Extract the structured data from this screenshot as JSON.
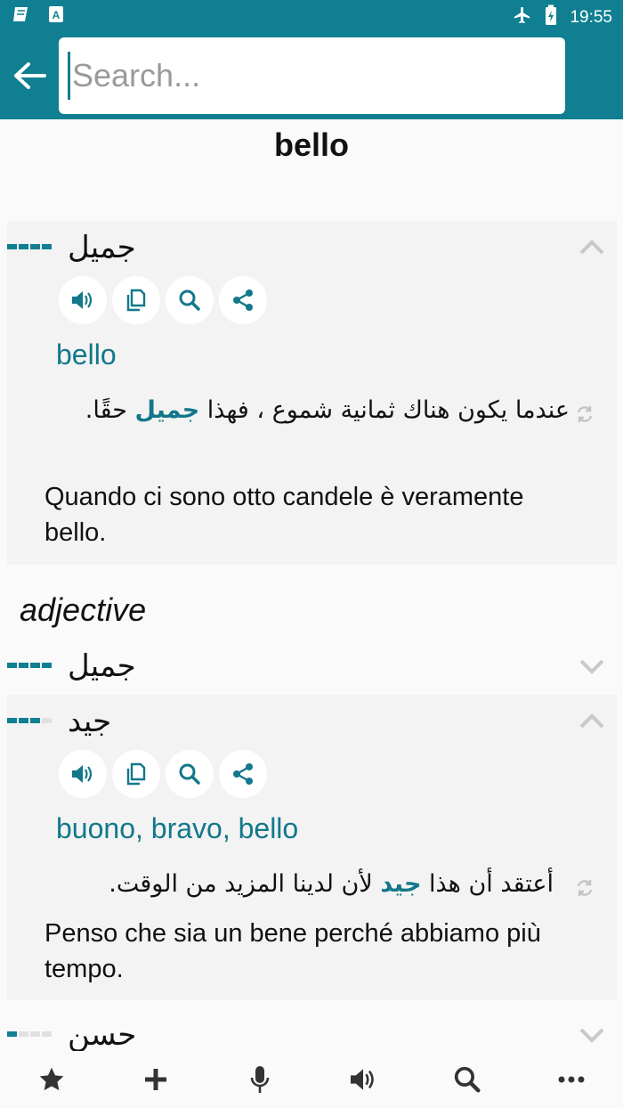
{
  "status_bar": {
    "time": "19:55",
    "icons": [
      "book-icon",
      "a-badge-icon",
      "airplane-icon",
      "battery-charging-icon"
    ]
  },
  "app_bar": {
    "back_icon": "arrow-left-icon",
    "search_placeholder": "Search...",
    "search_value": ""
  },
  "headword": "bello",
  "entries": [
    {
      "arabic": "جميل",
      "frequency": 4,
      "expanded": true,
      "actions": [
        "speaker-icon",
        "copy-icon",
        "search-icon",
        "share-icon"
      ],
      "translation": "bello",
      "example_ar_prefix": "عندما يكون هناك ثمانية شموع ، فهذا ",
      "example_ar_highlight": "جميل",
      "example_ar_suffix": " حقًا.",
      "example_it": "Quando ci sono otto candele è veramente bello."
    }
  ],
  "part_of_speech": "adjective",
  "pos_entries": [
    {
      "arabic": "جميل",
      "frequency": 4,
      "expanded": false
    },
    {
      "arabic": "جيد",
      "frequency": 3,
      "expanded": true,
      "actions": [
        "speaker-icon",
        "copy-icon",
        "search-icon",
        "share-icon"
      ],
      "translation": "buono, bravo, bello",
      "example_ar_prefix": "أعتقد أن هذا ",
      "example_ar_highlight": "جيد",
      "example_ar_suffix": " لأن لدينا المزيد من الوقت.",
      "example_it": "Penso che sia un bene perché abbiamo più tempo."
    },
    {
      "arabic": "حسن",
      "frequency": 1,
      "expanded": false
    }
  ],
  "bottom_nav": [
    "star-icon",
    "plus-icon",
    "microphone-icon",
    "speaker-icon",
    "search-icon",
    "more-icon"
  ],
  "colors": {
    "accent": "#0f7f91",
    "text_link": "#12788a",
    "card_bg": "#f3f3f3"
  }
}
